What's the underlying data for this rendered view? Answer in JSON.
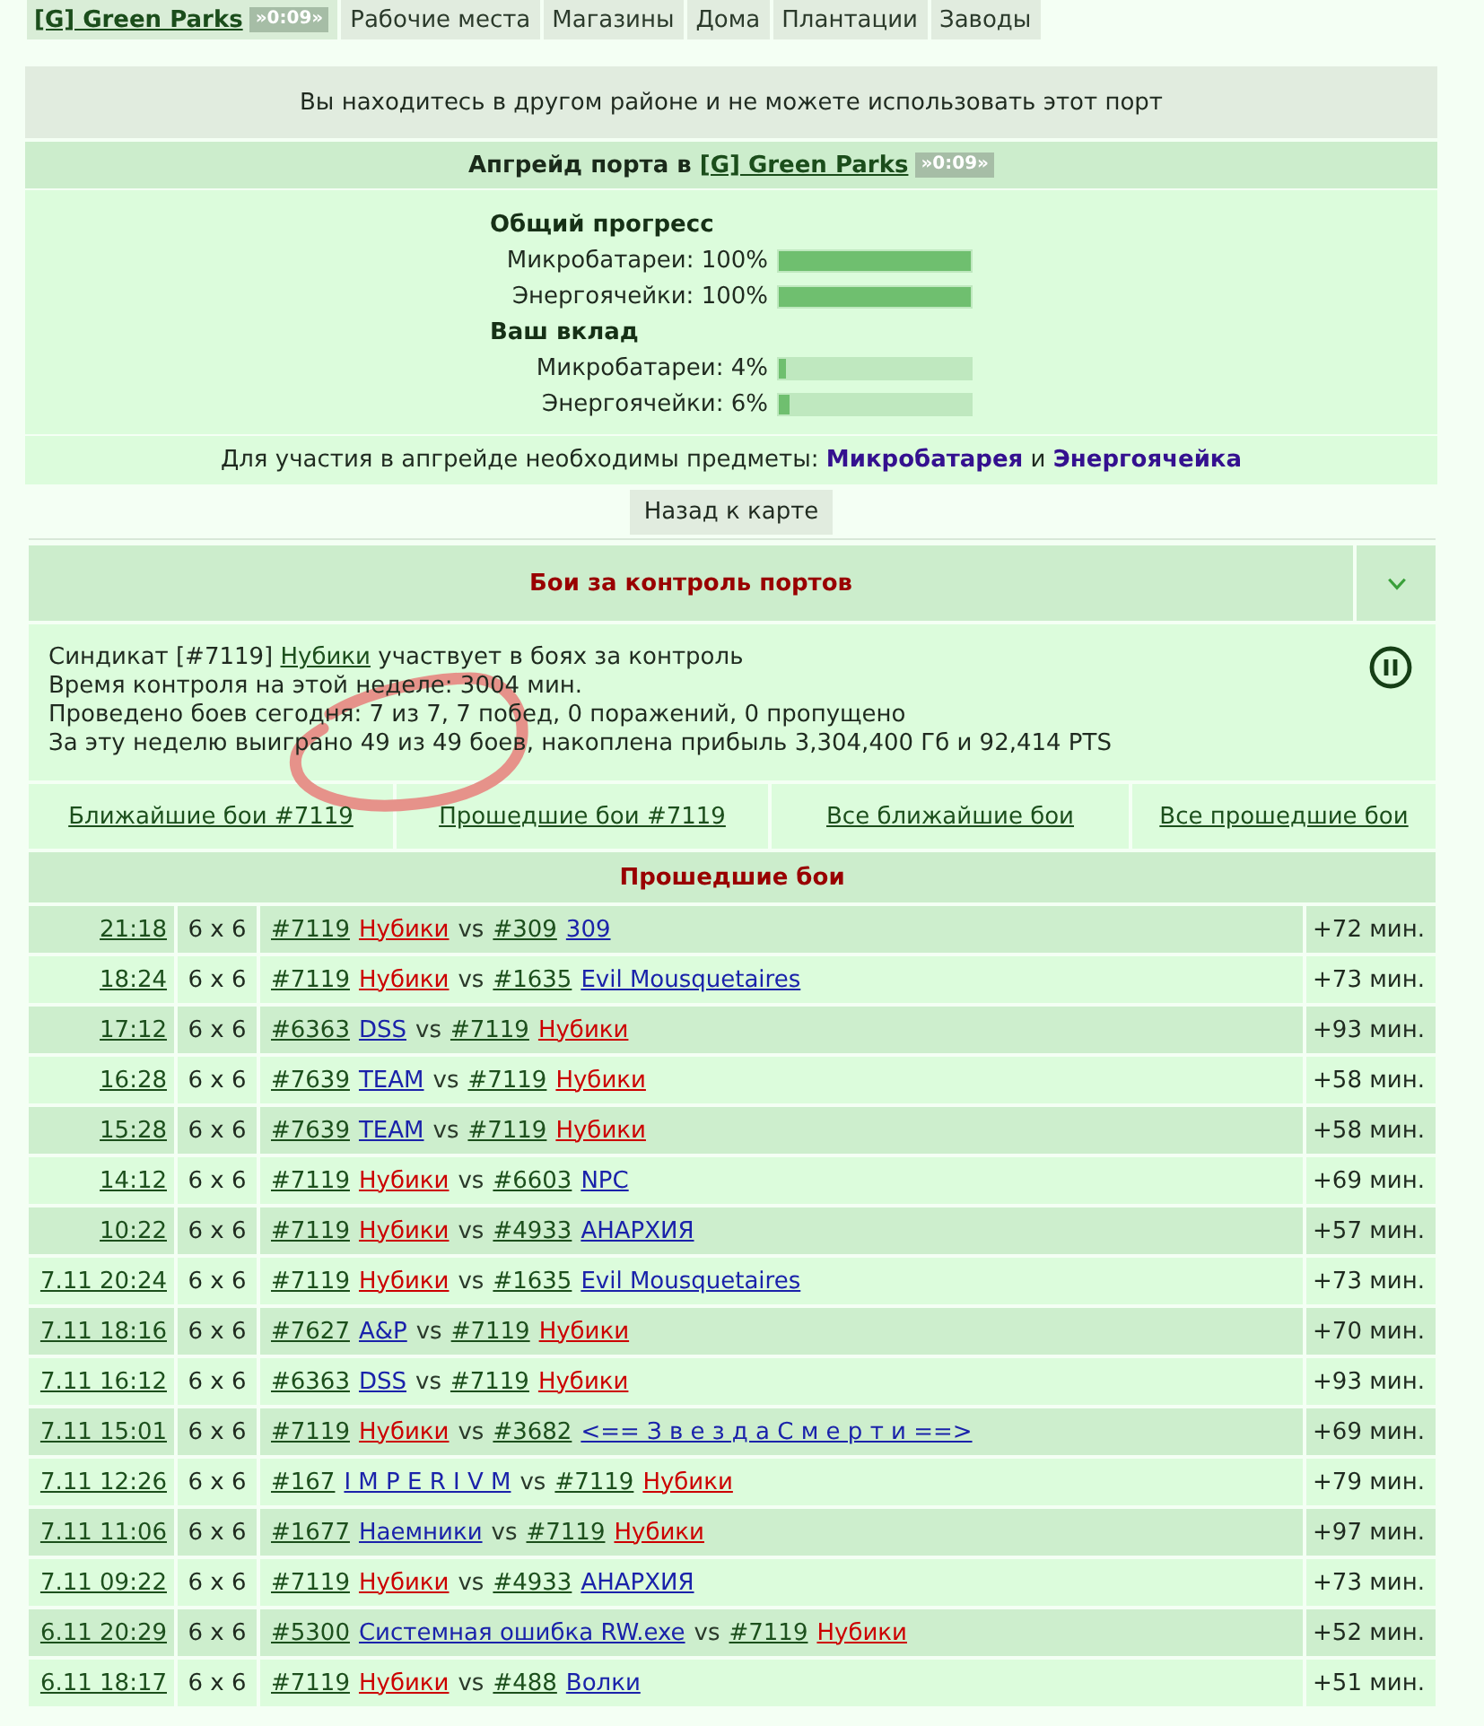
{
  "nav": {
    "district": {
      "name": "[G] Green Parks",
      "timer": "»0:09»"
    },
    "tabs": [
      {
        "label": "Рабочие места",
        "selected": false
      },
      {
        "label": "Магазины",
        "selected": false
      },
      {
        "label": "Дома",
        "selected": false
      },
      {
        "label": "Плантации",
        "selected": false
      },
      {
        "label": "Заводы",
        "selected": false
      }
    ]
  },
  "notice": "Вы находитесь в другом районе и не можете использовать этот порт",
  "upgrade": {
    "title": "Апгрейд порта в",
    "district": "[G] Green Parks",
    "timer": "»0:09»",
    "groups": [
      {
        "title": "Общий прогресс",
        "items": [
          {
            "label": "Микробатареи: 100%",
            "level": 1
          },
          {
            "label": "Энергоячейки: 100%",
            "level": 1
          }
        ]
      },
      {
        "title": "Ваш вклад",
        "items": [
          {
            "label": "Микробатареи: 4%",
            "level": 0.04
          },
          {
            "label": "Энергоячейки: 6%",
            "level": 0.06
          }
        ]
      }
    ],
    "requirement": {
      "text": "Для участия в апгрейде необходимы предметы:",
      "items": [
        "Микробатарея",
        "Энергоячейка"
      ],
      "joiner": "и"
    },
    "back_button": "Назад к карте"
  },
  "battles": {
    "title": "Бои за контроль портов",
    "syndicate_line": {
      "before": "Синдикат [#7119]",
      "link": "Нубики",
      "after": "участвует в боях за контроль"
    },
    "stats_lines": [
      "Время контроля на этой неделе: 3004 мин.",
      "Проведено боев сегодня: 7 из 7, 7 побед, 0 поражений, 0 пропущено",
      "За эту неделю выиграно 49 из 49 боев, накоплена прибыль 3,304,400 Гб и 92,414 PTS"
    ],
    "links": [
      "Ближайшие бои #7119",
      "Прошедшие бои #7119",
      "Все ближайшие бои",
      "Все прошедшие бои"
    ],
    "past_title": "Прошедшие бои",
    "rows": [
      {
        "time": "21:18",
        "format": "6 x 6",
        "team_1": {
          "id": "#7119",
          "name": "Нубики",
          "color": "#cc0000"
        },
        "vs": "vs",
        "team_2": {
          "id": "#309",
          "name": "309",
          "color": "#1a22aa"
        },
        "duration": "+72 мин."
      },
      {
        "time": "18:24",
        "format": "6 x 6",
        "team_1": {
          "id": "#7119",
          "name": "Нубики",
          "color": "#cc0000"
        },
        "vs": "vs",
        "team_2": {
          "id": "#1635",
          "name": "Evil Mousquetaires",
          "color": "#1a22aa"
        },
        "duration": "+73 мин."
      },
      {
        "time": "17:12",
        "format": "6 x 6",
        "team_1": {
          "id": "#6363",
          "name": "DSS",
          "color": "#1a22aa"
        },
        "vs": "vs",
        "team_2": {
          "id": "#7119",
          "name": "Нубики",
          "color": "#cc0000"
        },
        "duration": "+93 мин."
      },
      {
        "time": "16:28",
        "format": "6 x 6",
        "team_1": {
          "id": "#7639",
          "name": "TEAM",
          "color": "#1a22aa"
        },
        "vs": "vs",
        "team_2": {
          "id": "#7119",
          "name": "Нубики",
          "color": "#cc0000"
        },
        "duration": "+58 мин."
      },
      {
        "time": "15:28",
        "format": "6 x 6",
        "team_1": {
          "id": "#7639",
          "name": "TEAM",
          "color": "#1a22aa"
        },
        "vs": "vs",
        "team_2": {
          "id": "#7119",
          "name": "Нубики",
          "color": "#cc0000"
        },
        "duration": "+58 мин."
      },
      {
        "time": "14:12",
        "format": "6 x 6",
        "team_1": {
          "id": "#7119",
          "name": "Нубики",
          "color": "#cc0000"
        },
        "vs": "vs",
        "team_2": {
          "id": "#6603",
          "name": "NPC",
          "color": "#1a22aa"
        },
        "duration": "+69 мин."
      },
      {
        "time": "10:22",
        "format": "6 x 6",
        "team_1": {
          "id": "#7119",
          "name": "Нубики",
          "color": "#cc0000"
        },
        "vs": "vs",
        "team_2": {
          "id": "#4933",
          "name": "АНАРХИЯ",
          "color": "#1a22aa"
        },
        "duration": "+57 мин."
      },
      {
        "time": "7.11 20:24",
        "format": "6 x 6",
        "team_1": {
          "id": "#7119",
          "name": "Нубики",
          "color": "#cc0000"
        },
        "vs": "vs",
        "team_2": {
          "id": "#1635",
          "name": "Evil Mousquetaires",
          "color": "#1a22aa"
        },
        "duration": "+73 мин."
      },
      {
        "time": "7.11 18:16",
        "format": "6 x 6",
        "team_1": {
          "id": "#7627",
          "name": "A&P",
          "color": "#1a22aa"
        },
        "vs": "vs",
        "team_2": {
          "id": "#7119",
          "name": "Нубики",
          "color": "#cc0000"
        },
        "duration": "+70 мин."
      },
      {
        "time": "7.11 16:12",
        "format": "6 x 6",
        "team_1": {
          "id": "#6363",
          "name": "DSS",
          "color": "#1a22aa"
        },
        "vs": "vs",
        "team_2": {
          "id": "#7119",
          "name": "Нубики",
          "color": "#cc0000"
        },
        "duration": "+93 мин."
      },
      {
        "time": "7.11 15:01",
        "format": "6 x 6",
        "team_1": {
          "id": "#7119",
          "name": "Нубики",
          "color": "#cc0000"
        },
        "vs": "vs",
        "team_2": {
          "id": "#3682",
          "name": "<== З в е з д а С м е р т и ==>",
          "color": "#1a22aa"
        },
        "duration": "+69 мин."
      },
      {
        "time": "7.11 12:26",
        "format": "6 x 6",
        "team_1": {
          "id": "#167",
          "name": "I M P E R I V M",
          "color": "#1a22aa"
        },
        "vs": "vs",
        "team_2": {
          "id": "#7119",
          "name": "Нубики",
          "color": "#cc0000"
        },
        "duration": "+79 мин."
      },
      {
        "time": "7.11 11:06",
        "format": "6 x 6",
        "team_1": {
          "id": "#1677",
          "name": "Наемники",
          "color": "#1a22aa"
        },
        "vs": "vs",
        "team_2": {
          "id": "#7119",
          "name": "Нубики",
          "color": "#cc0000"
        },
        "duration": "+97 мин."
      },
      {
        "time": "7.11 09:22",
        "format": "6 x 6",
        "team_1": {
          "id": "#7119",
          "name": "Нубики",
          "color": "#cc0000"
        },
        "vs": "vs",
        "team_2": {
          "id": "#4933",
          "name": "АНАРХИЯ",
          "color": "#1a22aa"
        },
        "duration": "+73 мин."
      },
      {
        "time": "6.11 20:29",
        "format": "6 x 6",
        "team_1": {
          "id": "#5300",
          "name": "Системная ошибка RW.exe",
          "color": "#1a22aa"
        },
        "vs": "vs",
        "team_2": {
          "id": "#7119",
          "name": "Нубики",
          "color": "#cc0000"
        },
        "duration": "+52 мин."
      },
      {
        "time": "6.11 18:17",
        "format": "6 x 6",
        "team_1": {
          "id": "#7119",
          "name": "Нубики",
          "color": "#cc0000"
        },
        "vs": "vs",
        "team_2": {
          "id": "#488",
          "name": "Волки",
          "color": "#1a22aa"
        },
        "duration": "+51 мин."
      }
    ]
  }
}
